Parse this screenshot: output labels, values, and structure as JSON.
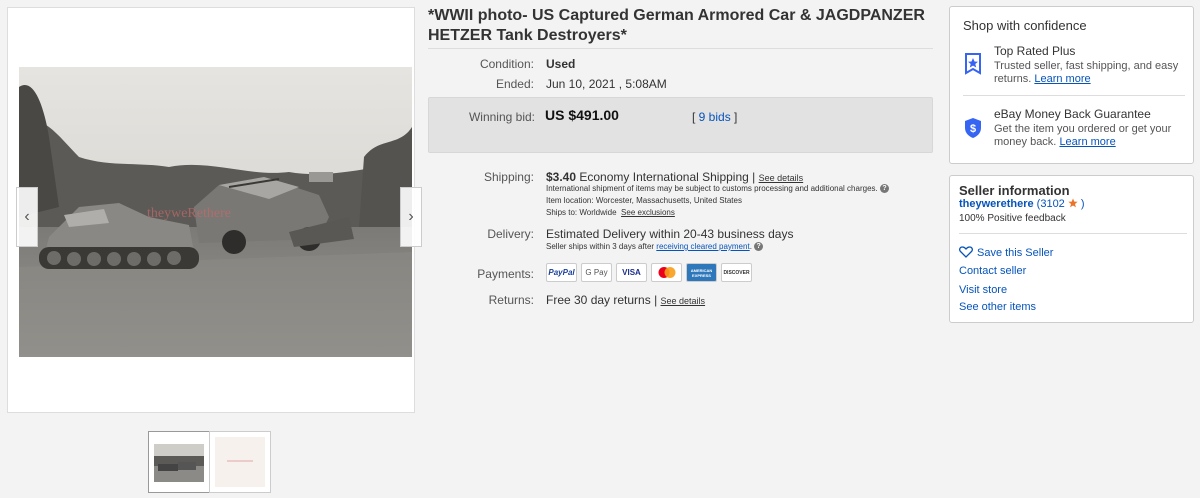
{
  "item": {
    "title": "*WWII photo- US Captured German Armored Car & JAGDPANZER HETZER Tank Destroyers*"
  },
  "image_gallery": {
    "watermark_text": "theyweRethere",
    "prev_icon": "chevron-left-icon",
    "next_icon": "chevron-right-icon"
  },
  "details": {
    "condition_label": "Condition:",
    "condition_value": "Used",
    "ended_label": "Ended:",
    "ended_value": "Jun 10, 2021 , 5:08AM",
    "winning_bid_label": "Winning bid:",
    "winning_bid_value": "US $491.00",
    "bids_link": "9 bids",
    "bids_open": "[ ",
    "bids_close": " ]"
  },
  "shipping": {
    "label": "Shipping:",
    "price": "$3.40",
    "service": "Economy International Shipping",
    "separator": "|",
    "see_details": "See details",
    "customs_note": "International shipment of items may be subject to customs processing and additional charges.",
    "item_location_label": "Item location:",
    "item_location": "Worcester, Massachusetts, United States",
    "ships_to_label": "Ships to:",
    "ships_to": "Worldwide",
    "see_exclusions": "See exclusions"
  },
  "delivery": {
    "label": "Delivery:",
    "estimate": "Estimated Delivery within 20-43 business days",
    "note_prefix": "Seller ships within 3 days after",
    "note_link": "receiving cleared payment",
    "note_suffix": "."
  },
  "payments": {
    "label": "Payments:",
    "methods": [
      "PayPal",
      "G Pay",
      "VISA",
      "mastercard",
      "AMERICAN EXPRESS",
      "DISCOVER"
    ]
  },
  "returns": {
    "label": "Returns:",
    "value": "Free 30 day returns",
    "separator": "|",
    "see_details": "See details"
  },
  "confidence": {
    "title": "Shop with confidence",
    "top_rated_title": "Top Rated Plus",
    "top_rated_desc": "Trusted seller, fast shipping, and easy returns.",
    "top_rated_link": "Learn more",
    "guarantee_title": "eBay Money Back Guarantee",
    "guarantee_desc": "Get the item you ordered or get your money back.",
    "guarantee_link": "Learn more"
  },
  "seller": {
    "title": "Seller information",
    "username": "theywerethere",
    "feedback_open": " (",
    "feedback_score": "3102",
    "feedback_close": " )",
    "positive_feedback": "100% Positive feedback",
    "save_seller": "Save this Seller",
    "contact": "Contact seller",
    "visit_store": "Visit store",
    "other_items": "See other items"
  },
  "colors": {
    "link": "#0654ba",
    "star": "#e8752a",
    "badge_blue": "#3665f3"
  }
}
